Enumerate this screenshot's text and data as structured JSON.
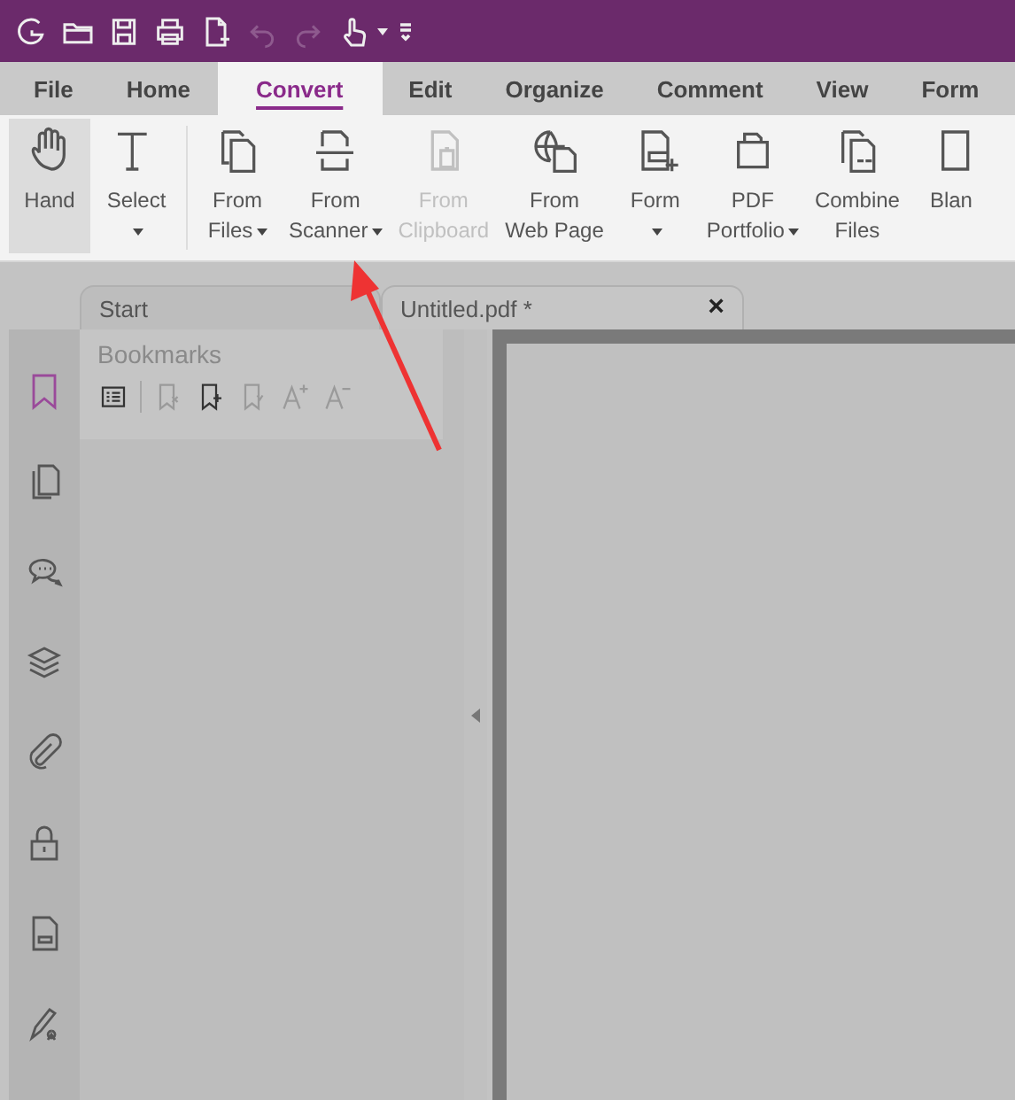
{
  "quick_access": [
    {
      "disabled": false,
      "dropdown": false
    },
    {
      "disabled": false,
      "dropdown": false
    },
    {
      "disabled": false,
      "dropdown": false
    },
    {
      "disabled": false,
      "dropdown": false
    },
    {
      "disabled": false,
      "dropdown": false
    },
    {
      "disabled": true,
      "dropdown": false
    },
    {
      "disabled": true,
      "dropdown": false
    },
    {
      "disabled": false,
      "dropdown": true
    },
    {
      "disabled": false,
      "dropdown": false
    }
  ],
  "menu_tabs": [
    {
      "label": "File",
      "selected": false
    },
    {
      "label": "Home",
      "selected": false
    },
    {
      "label": "Convert",
      "selected": true
    },
    {
      "label": "Edit",
      "selected": false
    },
    {
      "label": "Organize",
      "selected": false
    },
    {
      "label": "Comment",
      "selected": false
    },
    {
      "label": "View",
      "selected": false
    },
    {
      "label": "Form",
      "selected": false
    }
  ],
  "ribbon": [
    {
      "lines": [
        "Hand"
      ],
      "dropdown": false,
      "disabled": false,
      "selected": true
    },
    {
      "lines": [
        "Select"
      ],
      "dropdown": true,
      "dropdown_own_line": true,
      "disabled": false,
      "selected": false
    },
    {
      "lines": [
        "From",
        "Files"
      ],
      "dropdown": true,
      "dropdown_own_line": false,
      "disabled": false,
      "selected": false
    },
    {
      "lines": [
        "From",
        "Scanner"
      ],
      "dropdown": true,
      "dropdown_own_line": false,
      "disabled": false,
      "selected": false
    },
    {
      "lines": [
        "From",
        "Clipboard"
      ],
      "dropdown": false,
      "disabled": true,
      "selected": false
    },
    {
      "lines": [
        "From",
        "Web Page"
      ],
      "dropdown": false,
      "disabled": false,
      "selected": false
    },
    {
      "lines": [
        "Form"
      ],
      "dropdown": true,
      "dropdown_own_line": true,
      "disabled": false,
      "selected": false
    },
    {
      "lines": [
        "PDF",
        "Portfolio"
      ],
      "dropdown": true,
      "dropdown_own_line": false,
      "disabled": false,
      "selected": false
    },
    {
      "lines": [
        "Combine",
        "Files"
      ],
      "dropdown": false,
      "disabled": false,
      "selected": false
    },
    {
      "lines": [
        "Blan"
      ],
      "dropdown": false,
      "disabled": false,
      "selected": false
    }
  ],
  "doc_tabs": [
    {
      "label": "Start",
      "selected": false
    },
    {
      "label": "Untitled.pdf *",
      "selected": true,
      "close": "×"
    }
  ],
  "sidebar_icons": [
    {
      "selected": true
    },
    {
      "selected": false
    },
    {
      "selected": false
    },
    {
      "selected": false
    },
    {
      "selected": false
    },
    {
      "selected": false
    },
    {
      "selected": false
    },
    {
      "selected": false
    }
  ],
  "bookmarks": {
    "title": "Bookmarks",
    "tools": [
      {
        "disabled": false
      },
      {
        "disabled": true
      },
      {
        "disabled": false
      },
      {
        "disabled": true
      },
      {
        "disabled": true
      },
      {
        "disabled": true
      }
    ]
  }
}
